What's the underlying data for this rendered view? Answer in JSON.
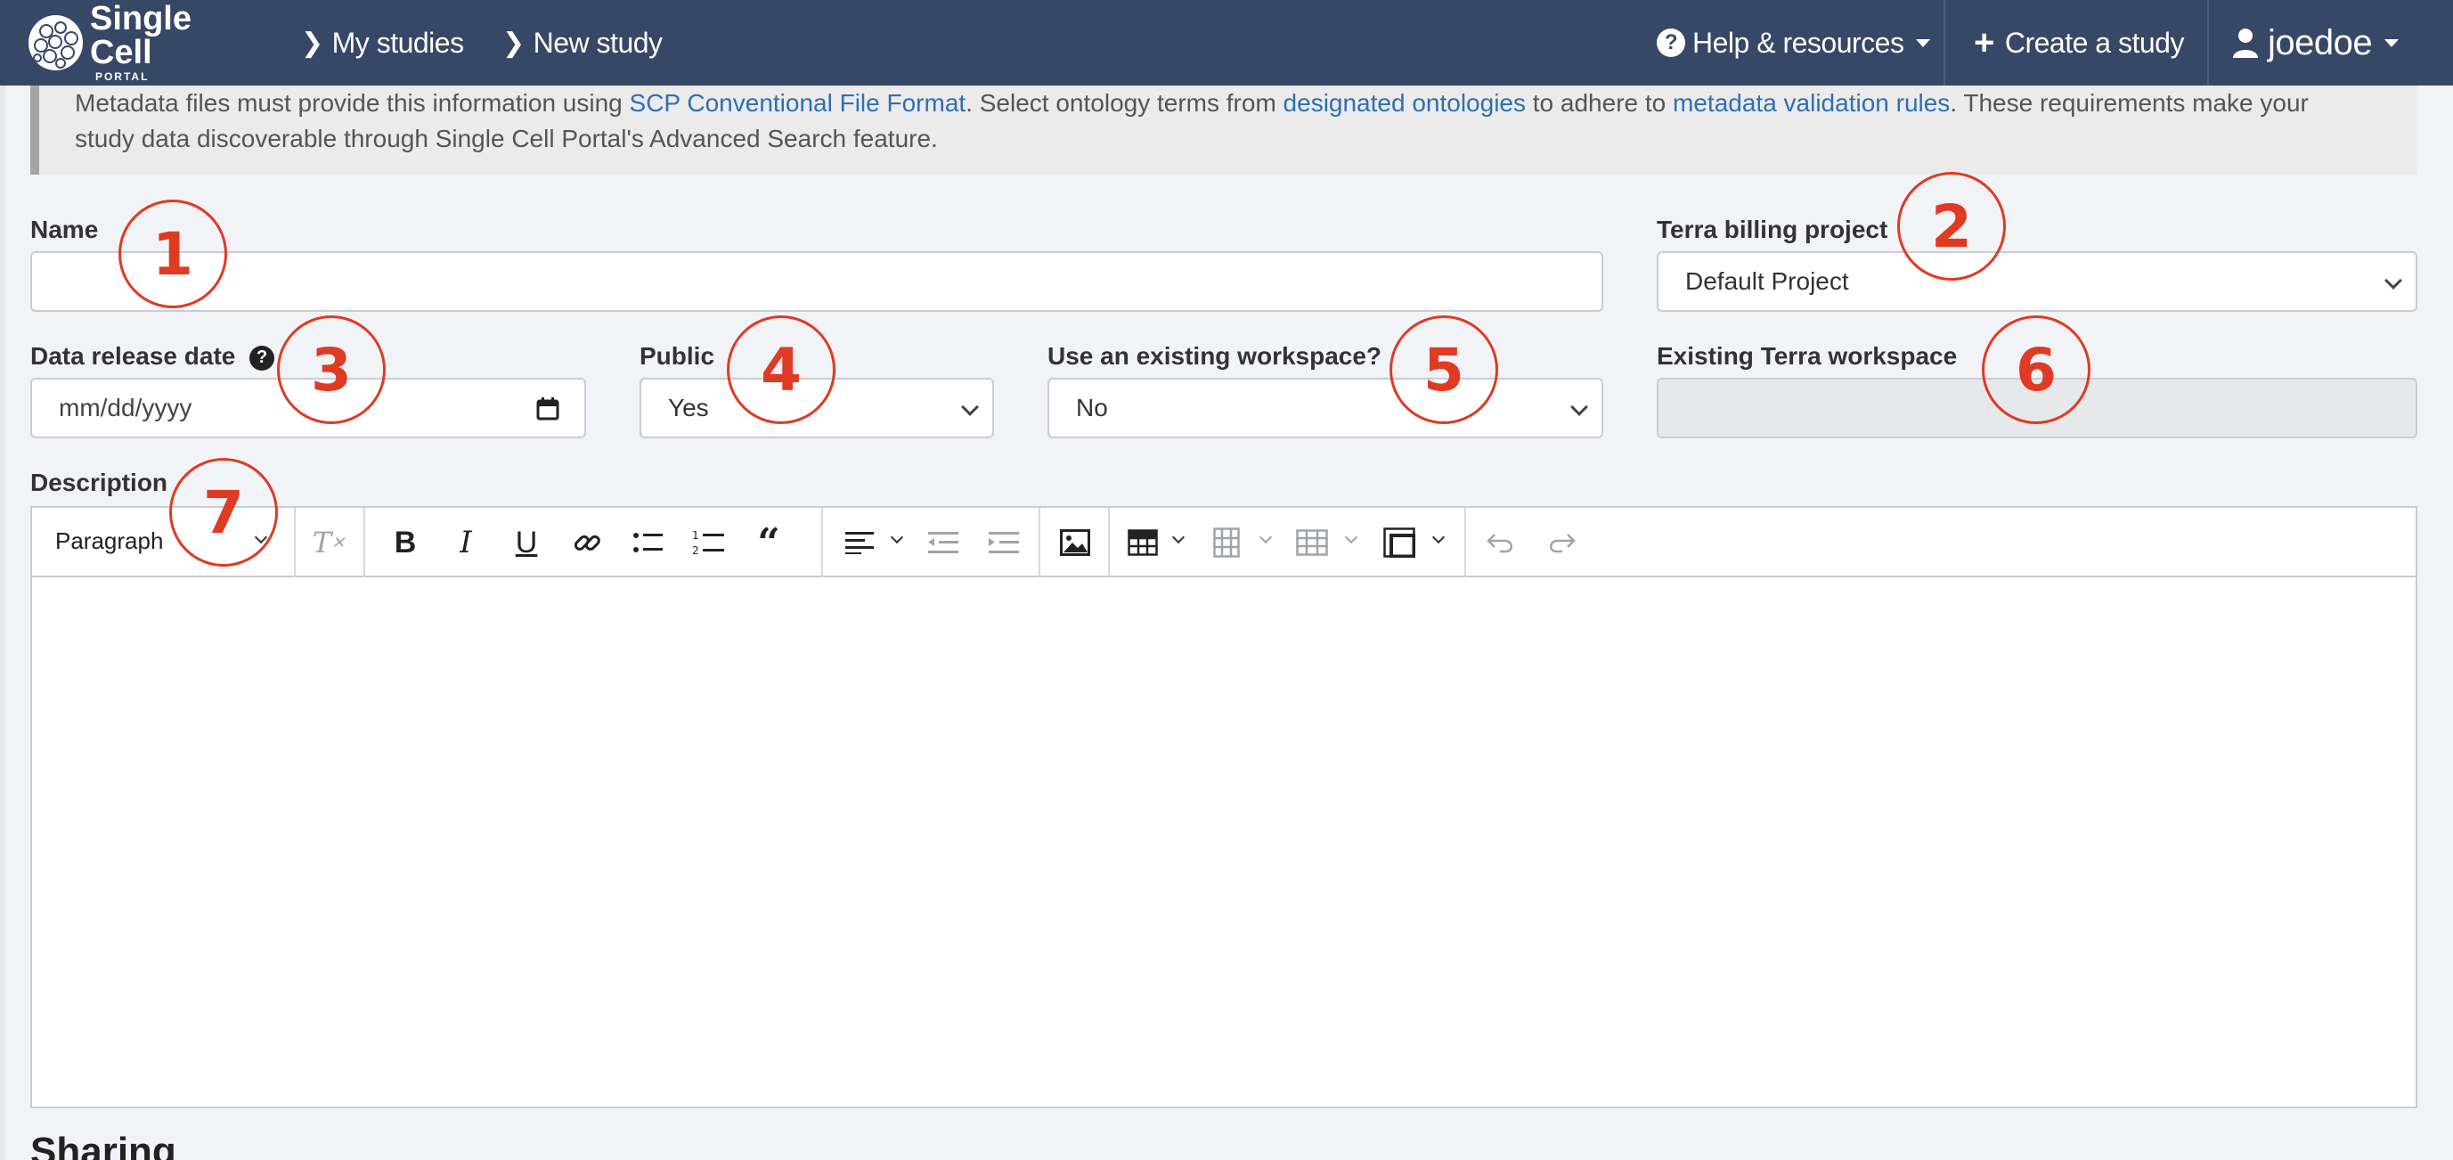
{
  "navbar": {
    "logo_text": "Single Cell",
    "logo_subtext": "PORTAL",
    "my_studies": "My studies",
    "new_study": "New study",
    "help": "Help & resources",
    "create_study": "Create a study",
    "user": "joedoe"
  },
  "notice": {
    "part1": "Metadata files must provide this information using ",
    "link1": "SCP Conventional File Format",
    "part2": ". Select ontology terms from ",
    "link2": "designated ontologies",
    "part3": " to adhere to ",
    "link3": "metadata validation rules",
    "part4": ". These requirements make your",
    "line2": "study data discoverable through Single Cell Portal's Advanced Search feature."
  },
  "form": {
    "name_label": "Name",
    "name_value": "",
    "billing_label": "Terra billing project",
    "billing_value": "Default Project",
    "release_label": "Data release date",
    "release_placeholder": "mm/dd/yyyy",
    "public_label": "Public",
    "public_value": "Yes",
    "workspace_q_label": "Use an existing workspace?",
    "workspace_q_value": "No",
    "existing_ws_label": "Existing Terra workspace",
    "existing_ws_value": "",
    "description_label": "Description"
  },
  "editor": {
    "block_format": "Paragraph"
  },
  "sharing": {
    "heading": "Sharing"
  },
  "annotations": [
    "1",
    "2",
    "3",
    "4",
    "5",
    "6",
    "7"
  ],
  "colors": {
    "navbar": "#374766",
    "annotation": "#e03a22",
    "link": "#2f6fb0",
    "page_bg": "#f1f3f7"
  }
}
